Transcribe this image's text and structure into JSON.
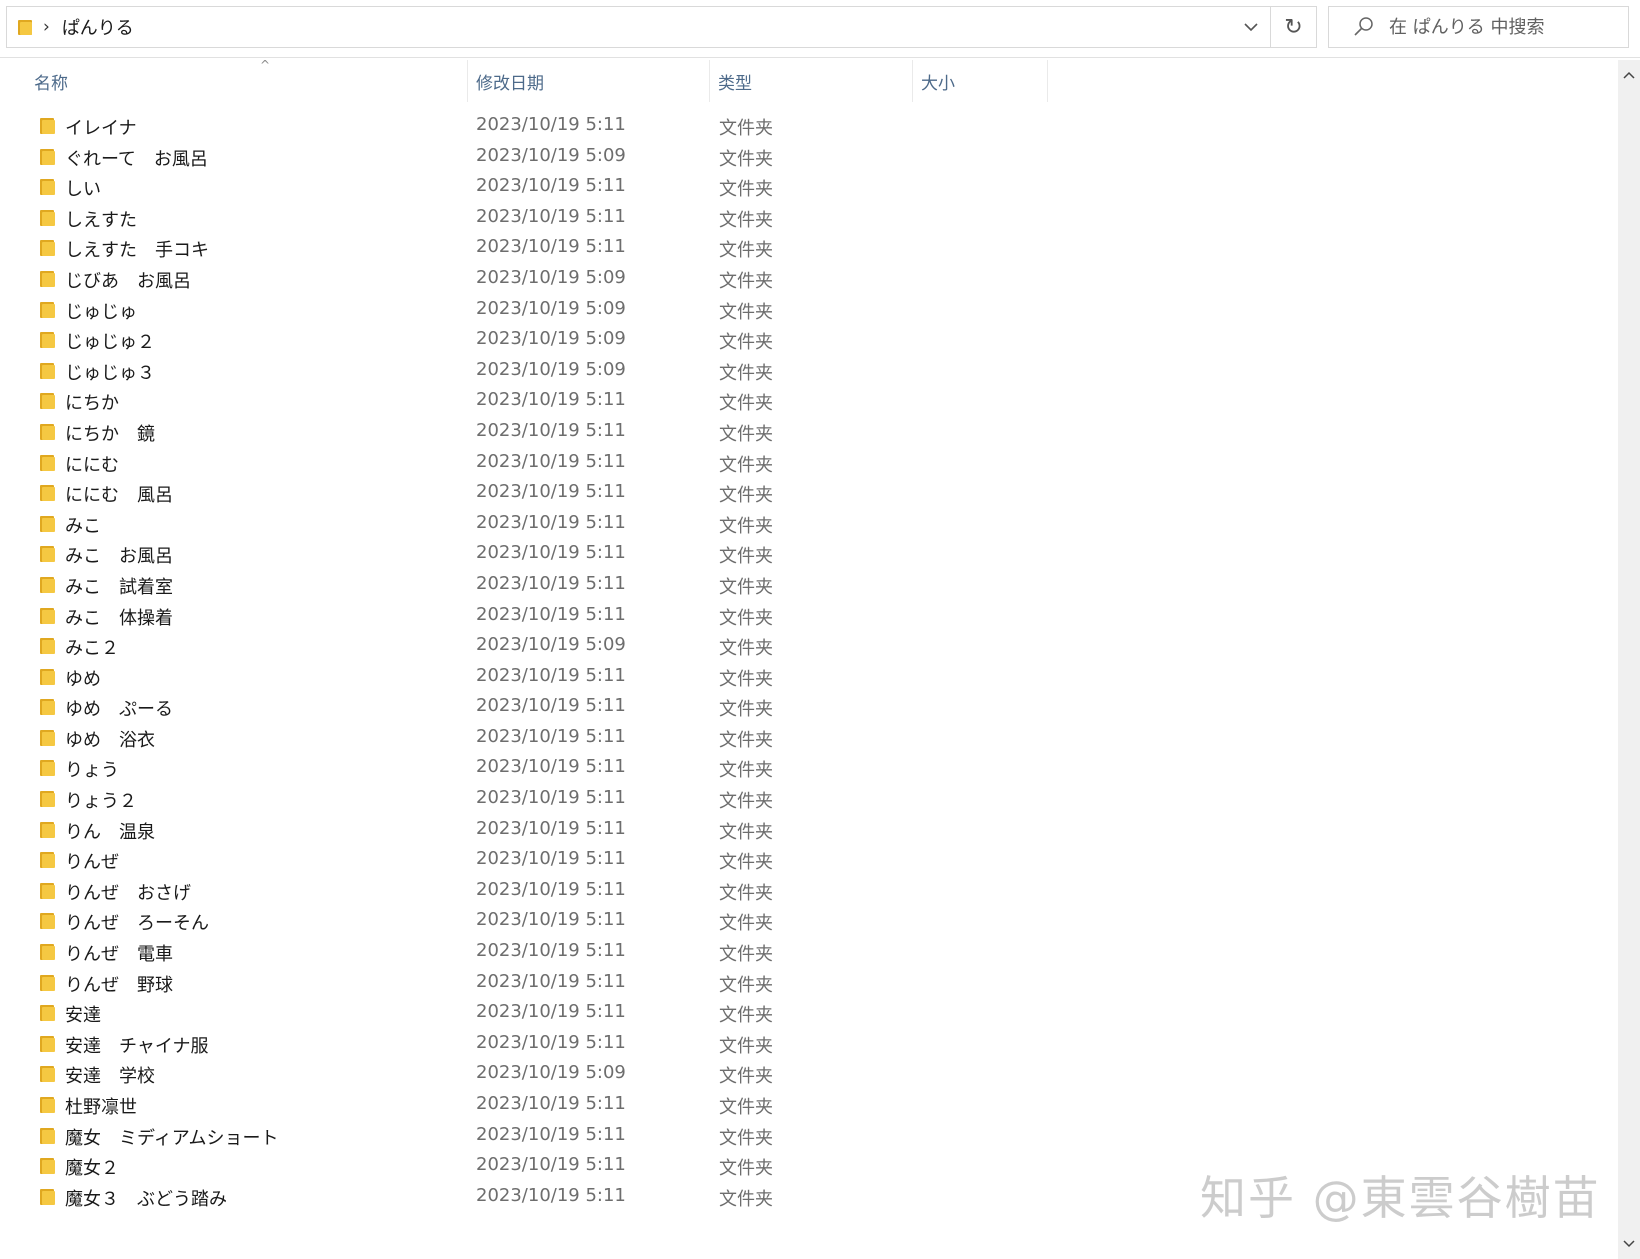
{
  "address_bar": {
    "path": "ぱんりる",
    "icons": {
      "folder": "folder-icon",
      "separator": "chevron-right-icon",
      "dropdown": "chevron-down-icon",
      "refresh": "refresh-icon"
    }
  },
  "search": {
    "placeholder": "在 ぱんりる 中搜索",
    "icon": "search-icon"
  },
  "columns": {
    "name": "名称",
    "date": "修改日期",
    "type": "类型",
    "size": "大小"
  },
  "files": [
    {
      "name": "イレイナ",
      "date": "2023/10/19 5:11",
      "type": "文件夹"
    },
    {
      "name": "ぐれーて　お風呂",
      "date": "2023/10/19 5:09",
      "type": "文件夹"
    },
    {
      "name": "しい",
      "date": "2023/10/19 5:11",
      "type": "文件夹"
    },
    {
      "name": "しえすた",
      "date": "2023/10/19 5:11",
      "type": "文件夹"
    },
    {
      "name": "しえすた　手コキ",
      "date": "2023/10/19 5:11",
      "type": "文件夹"
    },
    {
      "name": "じびあ　お風呂",
      "date": "2023/10/19 5:09",
      "type": "文件夹"
    },
    {
      "name": "じゅじゅ",
      "date": "2023/10/19 5:09",
      "type": "文件夹"
    },
    {
      "name": "じゅじゅ２",
      "date": "2023/10/19 5:09",
      "type": "文件夹"
    },
    {
      "name": "じゅじゅ３",
      "date": "2023/10/19 5:09",
      "type": "文件夹"
    },
    {
      "name": "にちか",
      "date": "2023/10/19 5:11",
      "type": "文件夹"
    },
    {
      "name": "にちか　鏡",
      "date": "2023/10/19 5:11",
      "type": "文件夹"
    },
    {
      "name": "ににむ",
      "date": "2023/10/19 5:11",
      "type": "文件夹"
    },
    {
      "name": "ににむ　風呂",
      "date": "2023/10/19 5:11",
      "type": "文件夹"
    },
    {
      "name": "みこ",
      "date": "2023/10/19 5:11",
      "type": "文件夹"
    },
    {
      "name": "みこ　お風呂",
      "date": "2023/10/19 5:11",
      "type": "文件夹"
    },
    {
      "name": "みこ　試着室",
      "date": "2023/10/19 5:11",
      "type": "文件夹"
    },
    {
      "name": "みこ　体操着",
      "date": "2023/10/19 5:11",
      "type": "文件夹"
    },
    {
      "name": "みこ２",
      "date": "2023/10/19 5:09",
      "type": "文件夹"
    },
    {
      "name": "ゆめ",
      "date": "2023/10/19 5:11",
      "type": "文件夹"
    },
    {
      "name": "ゆめ　ぷーる",
      "date": "2023/10/19 5:11",
      "type": "文件夹"
    },
    {
      "name": "ゆめ　浴衣",
      "date": "2023/10/19 5:11",
      "type": "文件夹"
    },
    {
      "name": "りょう",
      "date": "2023/10/19 5:11",
      "type": "文件夹"
    },
    {
      "name": "りょう２",
      "date": "2023/10/19 5:11",
      "type": "文件夹"
    },
    {
      "name": "りん　温泉",
      "date": "2023/10/19 5:11",
      "type": "文件夹"
    },
    {
      "name": "りんぜ",
      "date": "2023/10/19 5:11",
      "type": "文件夹"
    },
    {
      "name": "りんぜ　おさげ",
      "date": "2023/10/19 5:11",
      "type": "文件夹"
    },
    {
      "name": "りんぜ　ろーそん",
      "date": "2023/10/19 5:11",
      "type": "文件夹"
    },
    {
      "name": "りんぜ　電車",
      "date": "2023/10/19 5:11",
      "type": "文件夹"
    },
    {
      "name": "りんぜ　野球",
      "date": "2023/10/19 5:11",
      "type": "文件夹"
    },
    {
      "name": "安達",
      "date": "2023/10/19 5:11",
      "type": "文件夹"
    },
    {
      "name": "安達　チャイナ服",
      "date": "2023/10/19 5:11",
      "type": "文件夹"
    },
    {
      "name": "安達　学校",
      "date": "2023/10/19 5:09",
      "type": "文件夹"
    },
    {
      "name": "杜野凛世",
      "date": "2023/10/19 5:11",
      "type": "文件夹"
    },
    {
      "name": "魔女　ミディアムショート",
      "date": "2023/10/19 5:11",
      "type": "文件夹"
    },
    {
      "name": "魔女２",
      "date": "2023/10/19 5:11",
      "type": "文件夹"
    },
    {
      "name": "魔女３　ぶどう踏み",
      "date": "2023/10/19 5:11",
      "type": "文件夹"
    }
  ],
  "watermark": "知乎 @東雲谷樹苗",
  "colors": {
    "folder": "#f5c842",
    "folder_dark": "#e0a820",
    "header_text": "#4d6a8a",
    "meta_text": "#6d6d6d"
  }
}
